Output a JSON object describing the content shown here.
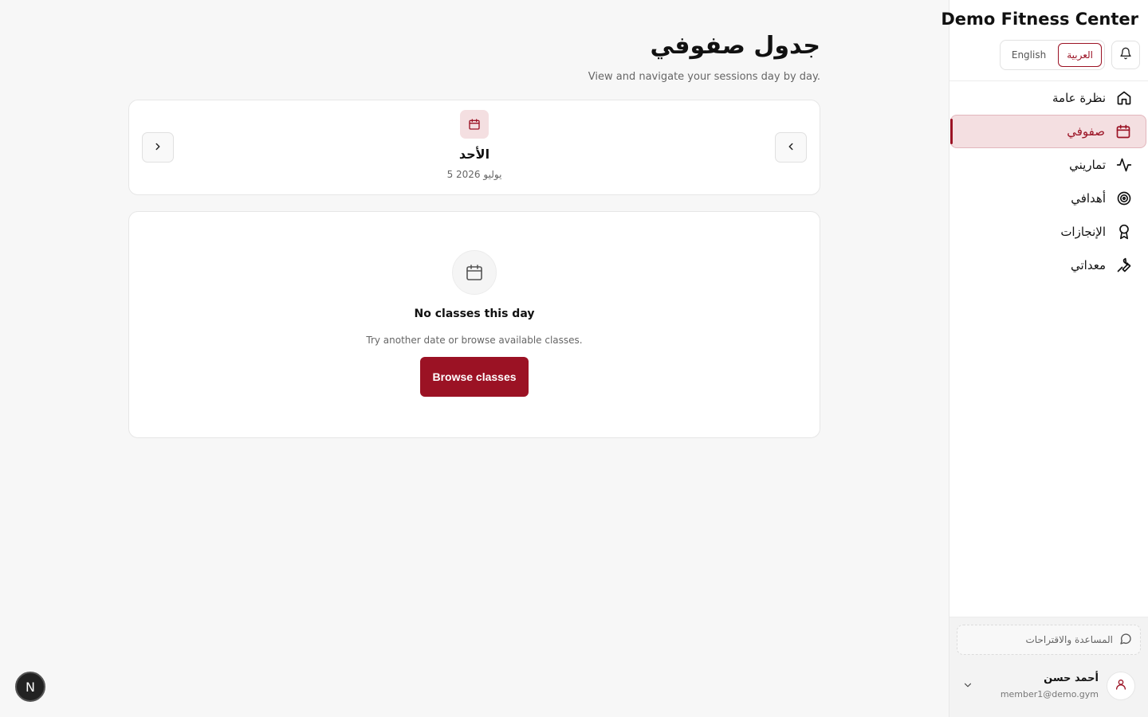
{
  "app": {
    "brand": "Demo Fitness Center",
    "accent_color": "#9b1224"
  },
  "header": {
    "languages": [
      {
        "label": "English",
        "active": false
      },
      {
        "label": "العربية",
        "active": true
      }
    ],
    "bell_icon": "bell-icon"
  },
  "sidebar": {
    "items": [
      {
        "label": "نظرة عامة",
        "icon": "home-icon",
        "active": false
      },
      {
        "label": "صفوفي",
        "icon": "calendar-icon",
        "active": true
      },
      {
        "label": "تماريني",
        "icon": "activity-icon",
        "active": false
      },
      {
        "label": "أهدافي",
        "icon": "target-icon",
        "active": false
      },
      {
        "label": "الإنجازات",
        "icon": "award-icon",
        "active": false
      },
      {
        "label": "معداتي",
        "icon": "wrench-icon",
        "active": false
      }
    ],
    "help_label": "المساعدة والاقتراحات",
    "user": {
      "name": "أحمد حسن",
      "email": "member1@demo.gym"
    }
  },
  "main": {
    "title": "جدول صفوفي",
    "subtitle": "View and navigate your sessions day by day.",
    "day": {
      "name": "الأحد",
      "date": "5 يوليو 2026"
    },
    "empty": {
      "title": "No classes this day",
      "subtitle": "Try another date or browse available classes.",
      "button": "Browse classes"
    }
  },
  "overlay": {
    "badge": "N"
  }
}
